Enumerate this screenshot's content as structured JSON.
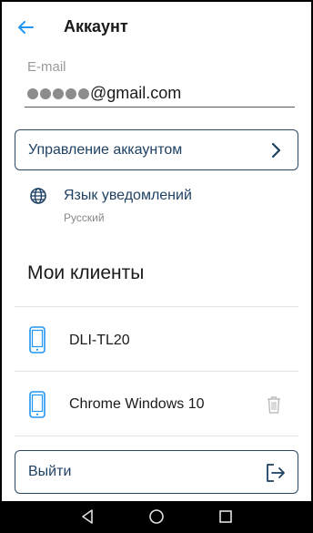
{
  "header": {
    "title": "Аккаунт"
  },
  "email": {
    "label": "E-mail",
    "masked_dots": 5,
    "domain": "@gmail.com"
  },
  "manage_account": {
    "label": "Управление аккаунтом"
  },
  "notifications_language": {
    "title": "Язык уведомлений",
    "value": "Русский"
  },
  "clients": {
    "title": "Мои клиенты",
    "items": [
      {
        "name": "DLI-TL20",
        "deletable": false
      },
      {
        "name": "Chrome Windows 10",
        "deletable": true
      }
    ]
  },
  "logout": {
    "label": "Выйти"
  },
  "colors": {
    "accent": "#2196f3",
    "primary_text": "#1f4163",
    "border": "#2b4a66",
    "divider": "#e2e2e2"
  }
}
